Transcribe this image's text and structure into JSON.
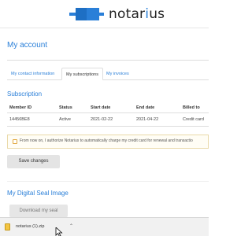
{
  "brand": {
    "name_prefix": "notar",
    "name_accent": "i",
    "name_suffix": "us",
    "accent_color": "#2a7fd8"
  },
  "page": {
    "title": "My account"
  },
  "tabs": [
    {
      "label": "My contact information",
      "active": false
    },
    {
      "label": "My subscriptions",
      "active": true
    },
    {
      "label": "My invoices",
      "active": false
    }
  ],
  "subscription": {
    "title": "Subscription",
    "columns": [
      "Member ID",
      "Status",
      "Start date",
      "End date",
      "Billed to"
    ],
    "rows": [
      {
        "member_id": "14456BE8",
        "status": "Active",
        "start": "2021-02-22",
        "end": "2021-04-22",
        "billed_to": "Credit card"
      }
    ]
  },
  "consent": {
    "text": "From now on, I authorize Notarius to automatically charge my credit card for renewal and transactio",
    "checked": false
  },
  "buttons": {
    "save": "Save changes",
    "download_seal": "Download my seal"
  },
  "seal": {
    "title": "My Digital Seal Image"
  },
  "download_bar": {
    "file_name": "notarius (1).zip",
    "icon": "zip-file-icon"
  }
}
